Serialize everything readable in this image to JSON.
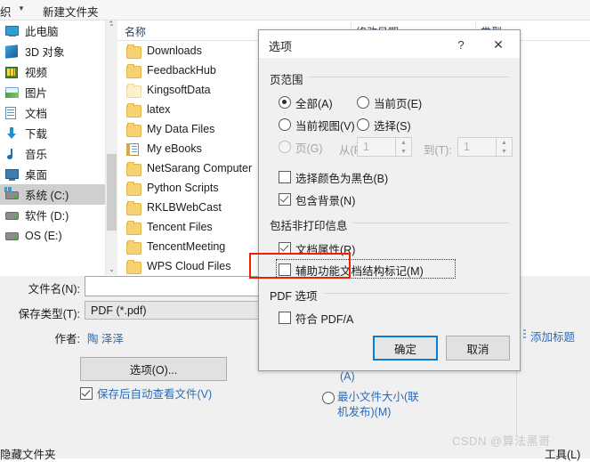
{
  "toolbar": {
    "organize_label": "织",
    "caret_icon": "▼",
    "new_folder_label": "新建文件夹"
  },
  "sidebar": {
    "scroll_up_icon": "⌃",
    "scroll_down_icon": "⌄",
    "items": [
      {
        "label": "此电脑",
        "icon": "this-pc-icon",
        "selected": false
      },
      {
        "label": "3D 对象",
        "icon": "3d-objects-icon",
        "selected": false
      },
      {
        "label": "视频",
        "icon": "videos-icon",
        "selected": false
      },
      {
        "label": "图片",
        "icon": "pictures-icon",
        "selected": false
      },
      {
        "label": "文档",
        "icon": "documents-icon",
        "selected": false
      },
      {
        "label": "下载",
        "icon": "downloads-icon",
        "selected": false
      },
      {
        "label": "音乐",
        "icon": "music-icon",
        "selected": false
      },
      {
        "label": "桌面",
        "icon": "desktop-icon",
        "selected": false
      },
      {
        "label": "系统 (C:)",
        "icon": "drive-icon",
        "selected": true
      },
      {
        "label": "软件 (D:)",
        "icon": "drive-icon",
        "selected": false
      },
      {
        "label": "OS (E:)",
        "icon": "drive-icon",
        "selected": false
      }
    ]
  },
  "file_list": {
    "columns": [
      {
        "label": "名称"
      },
      {
        "label": "修改日期"
      },
      {
        "label": "类型"
      }
    ],
    "sort_indicator_icon": "⌃",
    "rows": [
      {
        "name": "Downloads",
        "icon": "folder-icon"
      },
      {
        "name": "FeedbackHub",
        "icon": "folder-icon"
      },
      {
        "name": "KingsoftData",
        "icon": "folder-pale-icon"
      },
      {
        "name": "latex",
        "icon": "folder-icon"
      },
      {
        "name": "My Data Files",
        "icon": "folder-icon"
      },
      {
        "name": "My eBooks",
        "icon": "ebooks-icon"
      },
      {
        "name": "NetSarang Computer",
        "icon": "folder-icon"
      },
      {
        "name": "Python Scripts",
        "icon": "folder-icon"
      },
      {
        "name": "RKLBWebCast",
        "icon": "folder-icon"
      },
      {
        "name": "Tencent Files",
        "icon": "folder-icon"
      },
      {
        "name": "TencentMeeting",
        "icon": "folder-icon"
      },
      {
        "name": "WPS Cloud Files",
        "icon": "folder-icon"
      }
    ]
  },
  "save_form": {
    "filename_label": "文件名(N):",
    "filename_value": "",
    "filename_placeholder": "",
    "savetype_label": "保存类型(T):",
    "savetype_value": "PDF (*.pdf)",
    "author_label": "作者:",
    "author_value": "陶 泽泽",
    "options_button": "选项(O)...",
    "autoview_label": "保存后自动查看文件(V)",
    "autoview_checked": true,
    "hide_folders_label": "隐藏文件夹",
    "tools_label": "工具(L)"
  },
  "publish_options": {
    "standard_suffix": "(A)",
    "minimum_label": "最小文件大小(联机发布)(M)",
    "add_title_label": "添加标题"
  },
  "dialog": {
    "title": "选项",
    "help_icon": "?",
    "close_icon": "✕",
    "page_range": {
      "group_label": "页范围",
      "options": [
        {
          "label": "全部(A)",
          "selected": true,
          "disabled": false
        },
        {
          "label": "当前页(E)",
          "selected": false,
          "disabled": false
        },
        {
          "label": "当前视图(V)",
          "selected": false,
          "disabled": false
        },
        {
          "label": "选择(S)",
          "selected": false,
          "disabled": false
        },
        {
          "label": "页(G)",
          "selected": false,
          "disabled": true
        }
      ],
      "from_label": "从(F):",
      "from_value": "1",
      "to_label": "到(T):",
      "to_value": "1",
      "spin_up_icon": "▲",
      "spin_down_icon": "▼"
    },
    "checkboxes_top": [
      {
        "label": "选择颜色为黑色(B)",
        "checked": false
      },
      {
        "label": "包含背景(N)",
        "checked": true
      }
    ],
    "nonprint": {
      "group_label": "包括非打印信息",
      "checkboxes": [
        {
          "label": "文档属性(R)",
          "checked": true,
          "focused": false
        },
        {
          "label": "辅助功能文档结构标记(M)",
          "checked": false,
          "focused": true
        }
      ]
    },
    "pdf_options": {
      "group_label": "PDF 选项",
      "checkboxes": [
        {
          "label": "符合 PDF/A",
          "checked": false
        }
      ]
    },
    "buttons": {
      "ok": "确定",
      "cancel": "取消"
    }
  },
  "watermark": {
    "text": "CSDN @算法黑哥"
  },
  "colors": {
    "accent_blue": "#2b6cb8",
    "focus_blue": "#0a7bd6",
    "annotation_red": "#ef2000",
    "selection_gray": "#cfcfcf",
    "dialog_bg": "#f0f0f0"
  }
}
